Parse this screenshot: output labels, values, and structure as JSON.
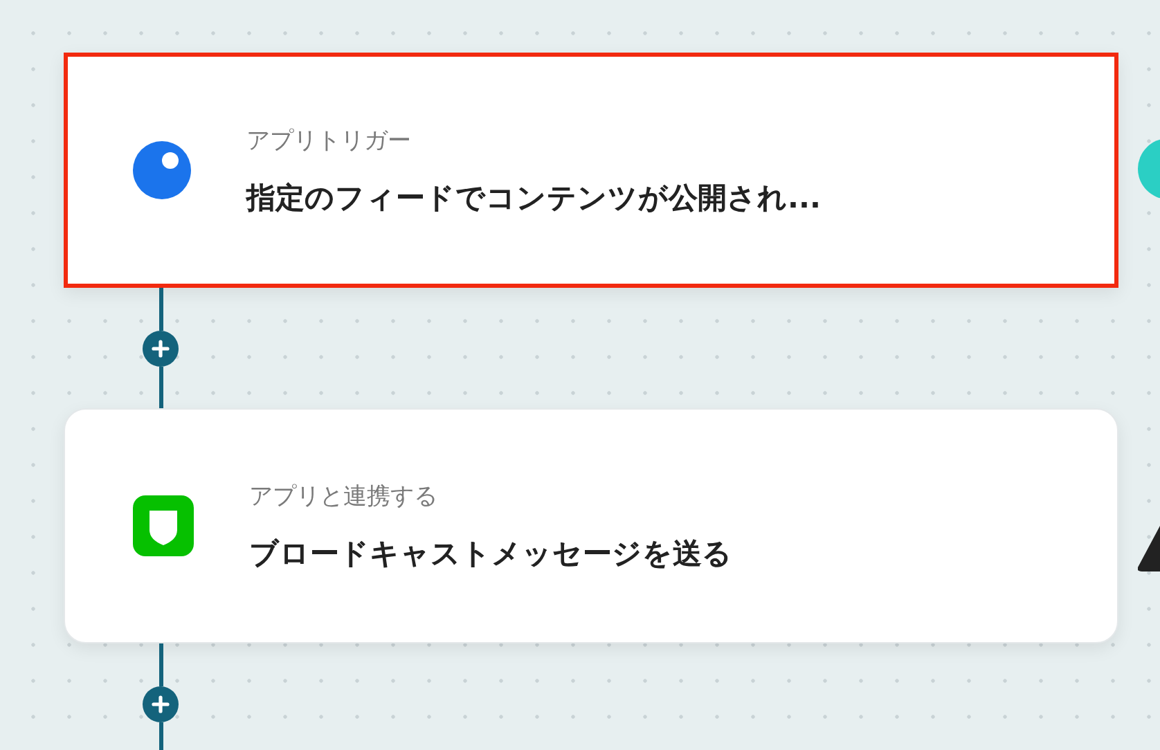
{
  "steps": [
    {
      "kind": "trigger",
      "label": "アプリトリガー",
      "title": "指定のフィードでコンテンツが公開され...",
      "selected": true
    },
    {
      "kind": "action",
      "label": "アプリと連携する",
      "title": "ブロードキャストメッセージを送る",
      "selected": false
    }
  ]
}
